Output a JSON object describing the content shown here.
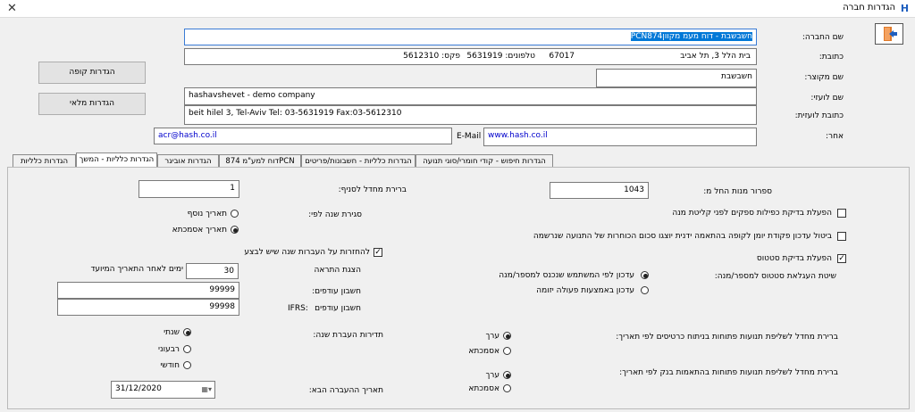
{
  "window": {
    "title": "הגדרות חברה",
    "icon": "H"
  },
  "form": {
    "company_name_label": "שם החברה:",
    "company_name_selected": "חשבשבת - דוח מעמ מקוון",
    "company_name_rest": "PCN874",
    "address_label": "כתובת:",
    "address_street": "בית הלל 3, תל אביב",
    "address_zip": "67017",
    "address_phones": "טלפונים: 5631919",
    "address_fax": "פקס: 5612310",
    "short_name_label": "שם מקוצר:",
    "short_name_value": "חשבשבת",
    "foreign_name_label": "שם לועזי:",
    "foreign_name_value": "hashavshevet - demo company",
    "foreign_address_label": "כתובת לועזית:",
    "foreign_address_value": "beit hilel 3,  Tel-Aviv    Tel: 03-5631919     Fax:03-5612310",
    "other_label": "אחר:",
    "email_label": "E-Mail",
    "email_value": "acr@hash.co.il",
    "website_value": "www.hash.co.il"
  },
  "buttons": {
    "cash_settings": "הגדרות קופה",
    "inventory_settings": "הגדרות מלאי"
  },
  "tabs": [
    "הגדרות חיפוש - קודי חומרי/סוגי תנועה",
    "הגדרות כלליות - חשבונות/פריטים",
    "דוח למע\"מ 874PCN",
    "הגדרות אוביגר",
    "הגדרות כלליות - המשך",
    "הגדרות כלליות"
  ],
  "right": {
    "opening_number_label": "ספרור מנות החל מ:",
    "opening_number_value": "1043",
    "chk1_label": "הפעלת בדיקת כפילות ספקים לפני קליטת מנה",
    "chk2_label": "ביטול עדכון פקודת יומן לקופה בהתאמה ידנית יוצגו סכום הכוחרות של התנועה שנרשמה",
    "chk3_label": "הפעלת בדיקת סטטוס",
    "method_label": "שיטת העגלאת סטטוס למספר/מנה:",
    "radio1_label": "עדכון לפי המשתמש שנכנס למספר/מנה",
    "radio2_label": "עדכון באמצעות פעולה יזומה",
    "default_filter_label": "ברירת מחדל לשליפת תנועות פתוחות בניתוח כרטיסים לפי תאריך:",
    "filter_opt1": "ערך",
    "filter_opt2": "אסמכתא",
    "default_bank_label": "ברירת מחדל לשליפת תנועות פתוחות בהתאמות בנק לפי תאריך:",
    "bank_opt1": "ערך",
    "bank_opt2": "אסמכתא"
  },
  "left": {
    "default_branch_label": "ברירת מחדל לסניף:",
    "default_branch_value": "1",
    "year_close_label": "סגירת שנה לפי:",
    "year_opt1": "תאריך נוסף",
    "year_opt2": "תאריך אסמכתא",
    "chk_return_label": "להחזרות על העברות שנה שיש לבצע",
    "alert_label": "הצגת התראה",
    "days_value": "30",
    "days_suffix": "ימים לאחר התאריך המיועד",
    "surplus_acc_label": "חשבון עודפים:",
    "surplus_acc_value": "99999",
    "surplus_ifrs_label": "חשבון עודפים",
    "ifrs_tag": "IFRS:",
    "surplus_ifrs_value": "99998",
    "transfer_freq_label": "תדירות העברת שנה:",
    "freq_opt1": "שנתי",
    "freq_opt2": "רבעוני",
    "freq_opt3": "חודשי",
    "next_transfer_label": "תאריך ההעברה הבא:",
    "next_transfer_value": "31/12/2020"
  }
}
